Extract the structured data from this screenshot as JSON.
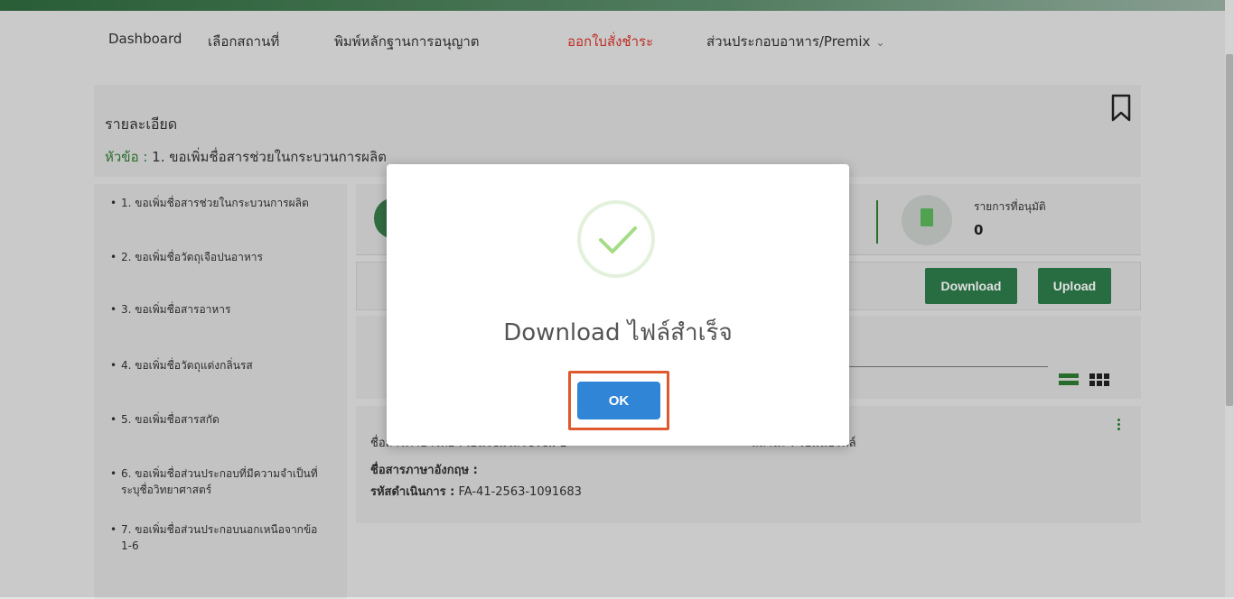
{
  "nav": {
    "items": [
      {
        "label": "Dashboard"
      },
      {
        "label": "เลือกสถานที่"
      },
      {
        "label": "พิมพ์หลักฐานการอนุญาต"
      },
      {
        "label": "ออกใบสั่งชำระ"
      },
      {
        "label": "ส่วนประกอบอาหาร/Premix"
      }
    ],
    "active_color": "#d9342b"
  },
  "detail": {
    "title": "รายละเอียด",
    "topic_label": "หัวข้อ :",
    "topic_value": " 1. ขอเพิ่มชื่อสารช่วยในกระบวนการผลิต"
  },
  "sidebar": {
    "items": [
      {
        "label": "1. ขอเพิ่มชื่อสารช่วยในกระบวนการผลิต"
      },
      {
        "label": "2. ขอเพิ่มชื่อวัตถุเจือปนอาหาร"
      },
      {
        "label": "3. ขอเพิ่มชื่อสารอาหาร"
      },
      {
        "label": "4. ขอเพิ่มชื่อวัตถุแต่งกลิ่นรส"
      },
      {
        "label": "5. ขอเพิ่มชื่อสารสกัด"
      },
      {
        "label": "6. ขอเพิ่มชื่อส่วนประกอบที่มีความจำเป็นที่ระบุชื่อวิทยาศาสตร์"
      },
      {
        "label": "7. ขอเพิ่มชื่อส่วนประกอบนอกเหนือจากข้อ 1-6"
      }
    ]
  },
  "stats": {
    "approved_label": "รายการที่อนุมัติ",
    "approved_value": "0"
  },
  "toolbar": {
    "download_label": "Download",
    "upload_label": "Upload"
  },
  "result": {
    "th_name": "ชื่อสารภาษาไทย : เอนไซม์ไลโซไซม์ 1",
    "status": "สถานะ : รอแนบไฟล์",
    "en_name_label": "ชื่อสารภาษาอังกฤษ :",
    "en_name_value": "",
    "op_code_label": "รหัสดำเนินการ :",
    "op_code_value": " FA-41-2563-1091683"
  },
  "modal": {
    "message": "Download ไฟล์สำเร็จ",
    "ok_label": "OK",
    "icon": "checkmark-icon",
    "accent": "#3085d6",
    "success_color": "#a5dc86"
  },
  "colors": {
    "brand_green": "#2e7d4a",
    "highlight": "#e0582f"
  }
}
